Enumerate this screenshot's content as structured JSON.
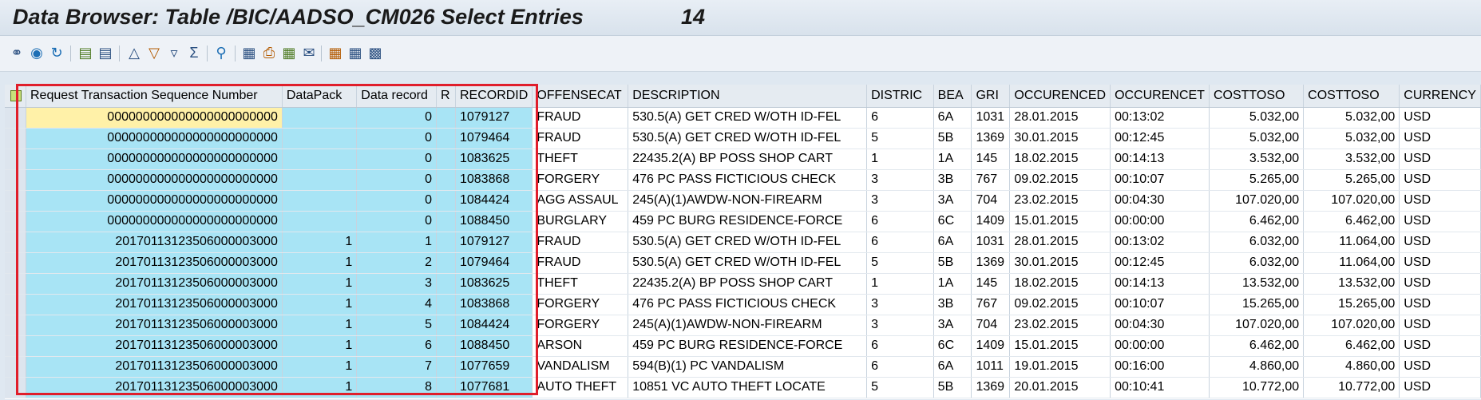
{
  "window": {
    "title": "Data Browser: Table /BIC/AADSO_CM026 Select Entries",
    "count": "14"
  },
  "toolbar": {
    "icons": [
      "glasses-icon",
      "display-icon",
      "refresh-icon",
      "detail-icon",
      "list-icon",
      "sort-up-icon",
      "sort-down-icon",
      "filter-icon",
      "sum-icon",
      "find-icon",
      "export-icon",
      "print-icon",
      "local-file-icon",
      "send-icon",
      "layout-icon",
      "grid-icon",
      "column-icon"
    ]
  },
  "table": {
    "columns": [
      {
        "key": "seq",
        "label": "Request Transaction Sequence Number",
        "width": 322,
        "align": "right",
        "isKey": true
      },
      {
        "key": "pack",
        "label": "DataPack",
        "width": 94,
        "align": "right",
        "isKey": true
      },
      {
        "key": "rec",
        "label": "Data record",
        "width": 100,
        "align": "right",
        "isKey": true
      },
      {
        "key": "r",
        "label": "R",
        "width": 24,
        "align": "left",
        "isKey": true
      },
      {
        "key": "rid",
        "label": "RECORDID",
        "width": 95,
        "align": "left",
        "isKey": true
      },
      {
        "key": "off",
        "label": "OFFENSECAT",
        "width": 120,
        "align": "left",
        "isKey": false
      },
      {
        "key": "desc",
        "label": "DESCRIPTION",
        "width": 300,
        "align": "left",
        "isKey": false
      },
      {
        "key": "dist",
        "label": "DISTRIC",
        "width": 84,
        "align": "left",
        "isKey": false
      },
      {
        "key": "bea",
        "label": "BEA",
        "width": 48,
        "align": "left",
        "isKey": false
      },
      {
        "key": "gri",
        "label": "GRI",
        "width": 48,
        "align": "left",
        "isKey": false
      },
      {
        "key": "occ",
        "label": "OCCURENCED",
        "width": 119,
        "align": "left",
        "isKey": false
      },
      {
        "key": "occt",
        "label": "OCCURENCET",
        "width": 121,
        "align": "left",
        "isKey": false
      },
      {
        "key": "c1",
        "label": "COSTTOSO",
        "width": 119,
        "align": "right",
        "isKey": false
      },
      {
        "key": "c2",
        "label": "COSTTOSO",
        "width": 121,
        "align": "right",
        "isKey": false
      },
      {
        "key": "cur",
        "label": "CURRENCY",
        "width": 99,
        "align": "left",
        "isKey": false
      }
    ],
    "rows": [
      {
        "seq": "000000000000000000000000",
        "pack": "",
        "rec": "0",
        "r": "",
        "rid": "1079127",
        "off": "FRAUD",
        "desc": "530.5(A) GET CRED W/OTH ID-FEL",
        "dist": "6",
        "bea": "6A",
        "gri": "1031",
        "occ": "28.01.2015",
        "occt": "00:13:02",
        "c1": "5.032,00",
        "c2": "5.032,00",
        "cur": "USD"
      },
      {
        "seq": "000000000000000000000000",
        "pack": "",
        "rec": "0",
        "r": "",
        "rid": "1079464",
        "off": "FRAUD",
        "desc": "530.5(A) GET CRED W/OTH ID-FEL",
        "dist": "5",
        "bea": "5B",
        "gri": "1369",
        "occ": "30.01.2015",
        "occt": "00:12:45",
        "c1": "5.032,00",
        "c2": "5.032,00",
        "cur": "USD"
      },
      {
        "seq": "000000000000000000000000",
        "pack": "",
        "rec": "0",
        "r": "",
        "rid": "1083625",
        "off": "THEFT",
        "desc": "22435.2(A) BP POSS SHOP CART",
        "dist": "1",
        "bea": "1A",
        "gri": "145",
        "occ": "18.02.2015",
        "occt": "00:14:13",
        "c1": "3.532,00",
        "c2": "3.532,00",
        "cur": "USD"
      },
      {
        "seq": "000000000000000000000000",
        "pack": "",
        "rec": "0",
        "r": "",
        "rid": "1083868",
        "off": "FORGERY",
        "desc": "476 PC PASS FICTICIOUS CHECK",
        "dist": "3",
        "bea": "3B",
        "gri": "767",
        "occ": "09.02.2015",
        "occt": "00:10:07",
        "c1": "5.265,00",
        "c2": "5.265,00",
        "cur": "USD"
      },
      {
        "seq": "000000000000000000000000",
        "pack": "",
        "rec": "0",
        "r": "",
        "rid": "1084424",
        "off": "AGG ASSAUL",
        "desc": "245(A)(1)AWDW-NON-FIREARM",
        "dist": "3",
        "bea": "3A",
        "gri": "704",
        "occ": "23.02.2015",
        "occt": "00:04:30",
        "c1": "107.020,00",
        "c2": "107.020,00",
        "cur": "USD"
      },
      {
        "seq": "000000000000000000000000",
        "pack": "",
        "rec": "0",
        "r": "",
        "rid": "1088450",
        "off": "BURGLARY",
        "desc": "459 PC BURG RESIDENCE-FORCE",
        "dist": "6",
        "bea": "6C",
        "gri": "1409",
        "occ": "15.01.2015",
        "occt": "00:00:00",
        "c1": "6.462,00",
        "c2": "6.462,00",
        "cur": "USD"
      },
      {
        "seq": "20170113123506000003000",
        "pack": "1",
        "rec": "1",
        "r": "",
        "rid": "1079127",
        "off": "FRAUD",
        "desc": "530.5(A) GET CRED W/OTH ID-FEL",
        "dist": "6",
        "bea": "6A",
        "gri": "1031",
        "occ": "28.01.2015",
        "occt": "00:13:02",
        "c1": "6.032,00",
        "c2": "11.064,00",
        "cur": "USD"
      },
      {
        "seq": "20170113123506000003000",
        "pack": "1",
        "rec": "2",
        "r": "",
        "rid": "1079464",
        "off": "FRAUD",
        "desc": "530.5(A) GET CRED W/OTH ID-FEL",
        "dist": "5",
        "bea": "5B",
        "gri": "1369",
        "occ": "30.01.2015",
        "occt": "00:12:45",
        "c1": "6.032,00",
        "c2": "11.064,00",
        "cur": "USD"
      },
      {
        "seq": "20170113123506000003000",
        "pack": "1",
        "rec": "3",
        "r": "",
        "rid": "1083625",
        "off": "THEFT",
        "desc": "22435.2(A) BP POSS SHOP CART",
        "dist": "1",
        "bea": "1A",
        "gri": "145",
        "occ": "18.02.2015",
        "occt": "00:14:13",
        "c1": "13.532,00",
        "c2": "13.532,00",
        "cur": "USD"
      },
      {
        "seq": "20170113123506000003000",
        "pack": "1",
        "rec": "4",
        "r": "",
        "rid": "1083868",
        "off": "FORGERY",
        "desc": "476 PC PASS FICTICIOUS CHECK",
        "dist": "3",
        "bea": "3B",
        "gri": "767",
        "occ": "09.02.2015",
        "occt": "00:10:07",
        "c1": "15.265,00",
        "c2": "15.265,00",
        "cur": "USD"
      },
      {
        "seq": "20170113123506000003000",
        "pack": "1",
        "rec": "5",
        "r": "",
        "rid": "1084424",
        "off": "FORGERY",
        "desc": "245(A)(1)AWDW-NON-FIREARM",
        "dist": "3",
        "bea": "3A",
        "gri": "704",
        "occ": "23.02.2015",
        "occt": "00:04:30",
        "c1": "107.020,00",
        "c2": "107.020,00",
        "cur": "USD"
      },
      {
        "seq": "20170113123506000003000",
        "pack": "1",
        "rec": "6",
        "r": "",
        "rid": "1088450",
        "off": "ARSON",
        "desc": "459 PC BURG RESIDENCE-FORCE",
        "dist": "6",
        "bea": "6C",
        "gri": "1409",
        "occ": "15.01.2015",
        "occt": "00:00:00",
        "c1": "6.462,00",
        "c2": "6.462,00",
        "cur": "USD"
      },
      {
        "seq": "20170113123506000003000",
        "pack": "1",
        "rec": "7",
        "r": "",
        "rid": "1077659",
        "off": "VANDALISM",
        "desc": "594(B)(1) PC VANDALISM",
        "dist": "6",
        "bea": "6A",
        "gri": "1011",
        "occ": "19.01.2015",
        "occt": "00:16:00",
        "c1": "4.860,00",
        "c2": "4.860,00",
        "cur": "USD"
      },
      {
        "seq": "20170113123506000003000",
        "pack": "1",
        "rec": "8",
        "r": "",
        "rid": "1077681",
        "off": "AUTO THEFT",
        "desc": "10851 VC AUTO THEFT LOCATE",
        "dist": "5",
        "bea": "5B",
        "gri": "1369",
        "occ": "20.01.2015",
        "occt": "00:10:41",
        "c1": "10.772,00",
        "c2": "10.772,00",
        "cur": "USD"
      }
    ]
  }
}
